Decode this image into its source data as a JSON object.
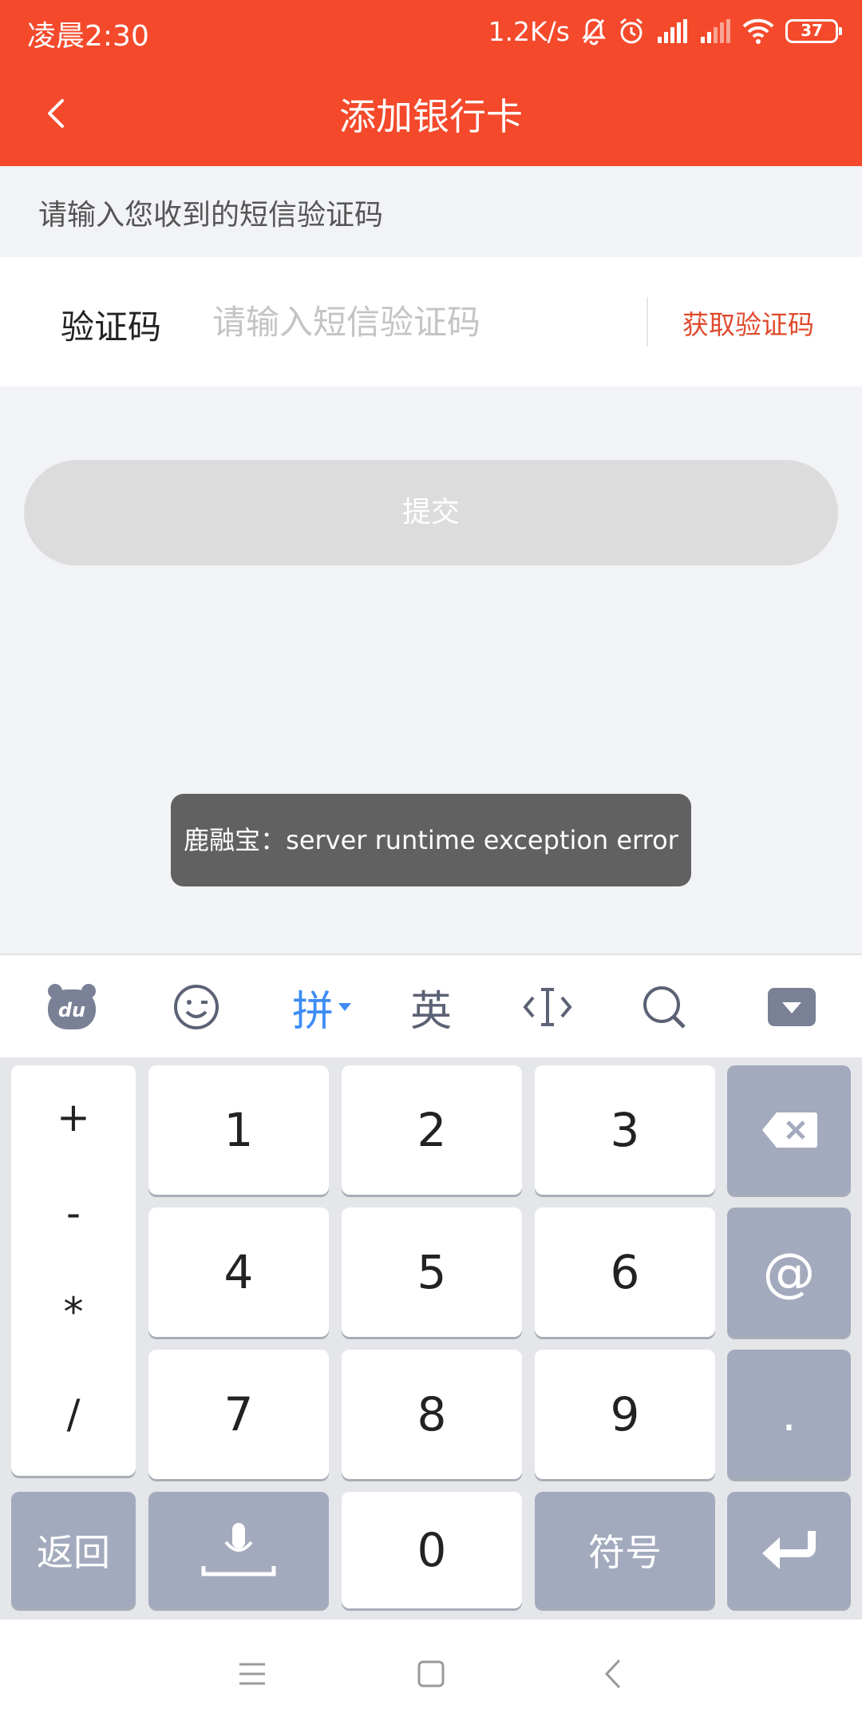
{
  "status": {
    "time": "凌晨2:30",
    "speed": "1.2K/s",
    "battery": "37"
  },
  "header": {
    "title": "添加银行卡"
  },
  "form": {
    "hint": "请输入您收到的短信验证码",
    "code_label": "验证码",
    "code_placeholder": "请输入短信验证码",
    "code_value": "",
    "get_code_label": "获取验证码",
    "submit_label": "提交"
  },
  "toast": {
    "message": "鹿融宝：server runtime exception error"
  },
  "keyboard": {
    "toolbar": {
      "pinyin_label": "拼",
      "english_label": "英"
    },
    "side_symbols": [
      "+",
      "-",
      "*",
      "/"
    ],
    "digits": [
      "1",
      "2",
      "3",
      "4",
      "5",
      "6",
      "7",
      "8",
      "9",
      "0"
    ],
    "at_label": "@",
    "dot_label": ".",
    "back_label": "返回",
    "symbols_label": "符号"
  },
  "colors": {
    "brand": "#f4492b",
    "accent_text": "#e04a2d",
    "toolbar_active": "#3d8df5"
  }
}
